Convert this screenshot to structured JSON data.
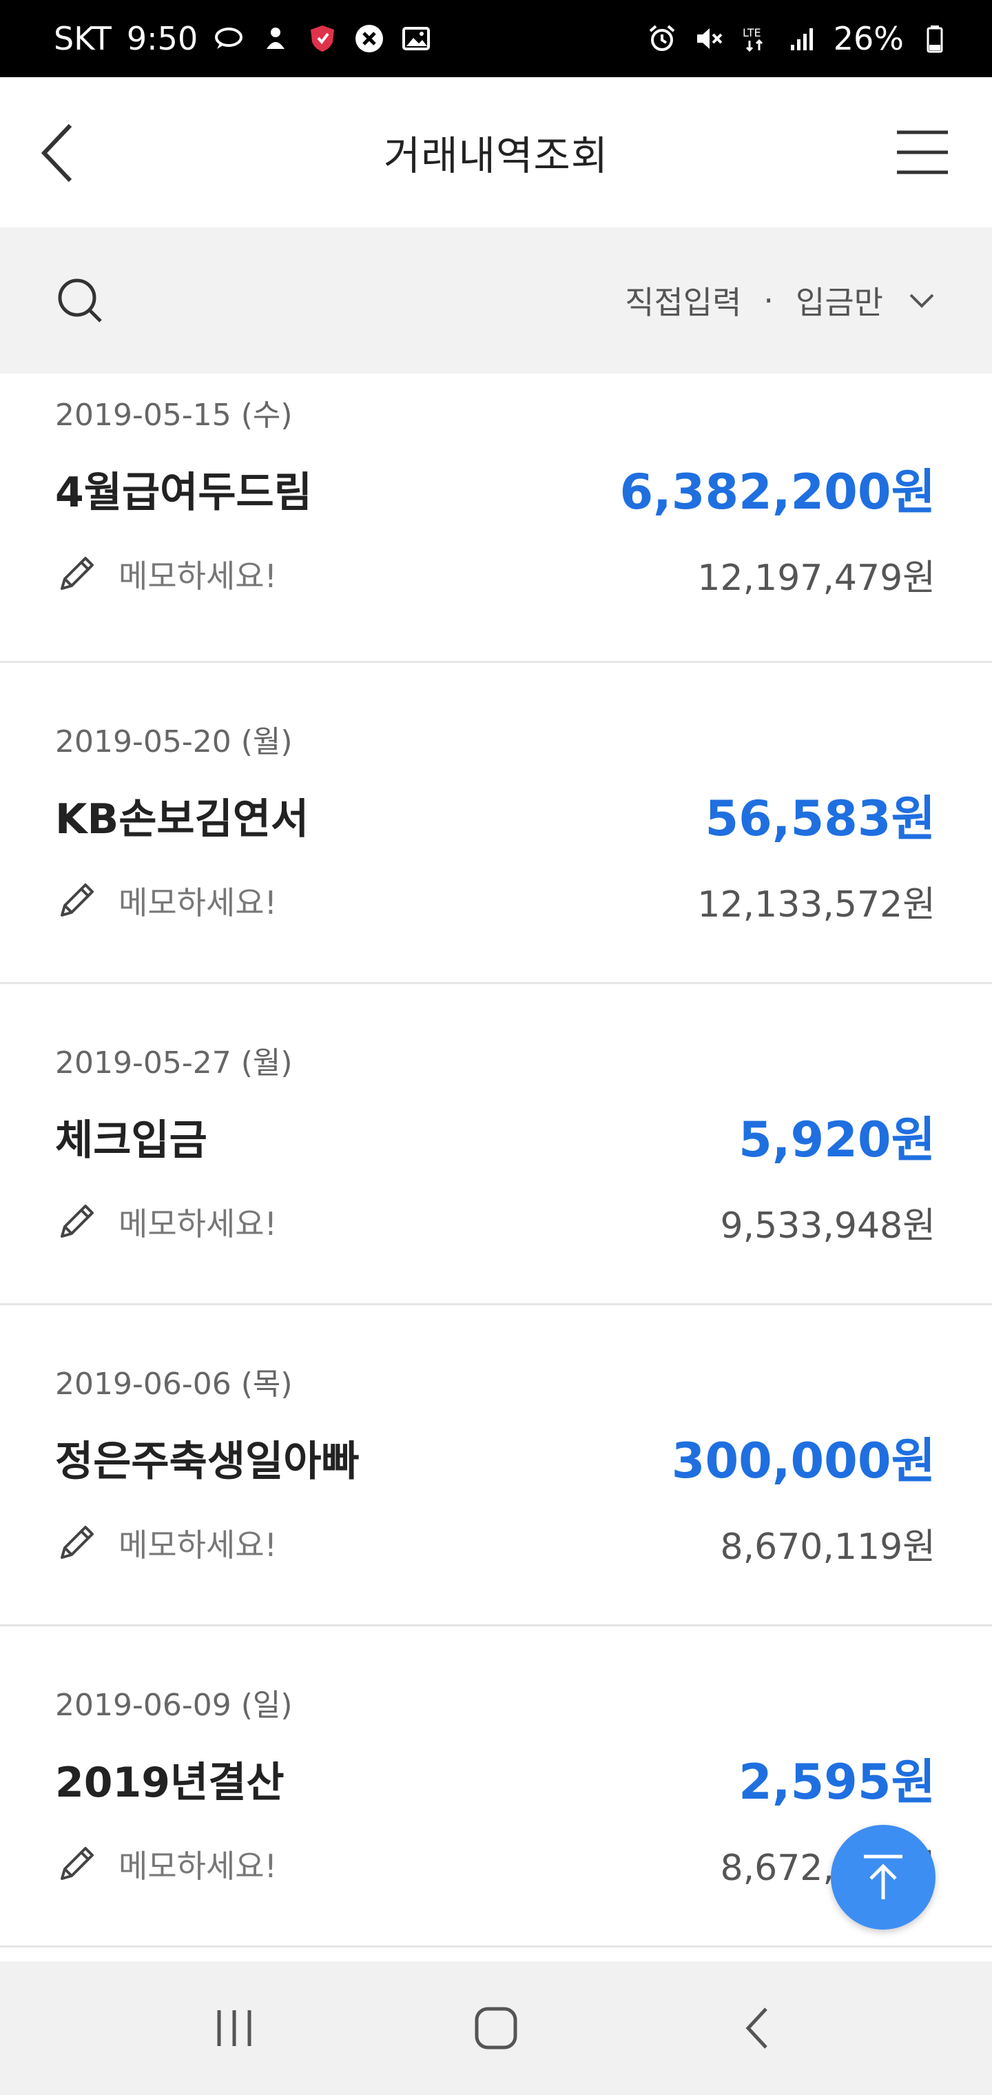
{
  "status_bar": {
    "carrier": "SKT",
    "time": "9:50",
    "battery": "26%",
    "icons_left": [
      "chat-icon",
      "notification-icon",
      "shield-icon",
      "close-circle-icon",
      "image-icon"
    ],
    "icons_right": [
      "alarm-icon",
      "mute-icon",
      "lte-icon",
      "signal-icon",
      "battery-icon"
    ]
  },
  "header": {
    "title": "거래내역조회"
  },
  "filter": {
    "mode": "직접입력",
    "separator": "·",
    "type": "입금만"
  },
  "transactions": [
    {
      "date": "2019-05-15 (수)",
      "name": "4월급여두드림",
      "amount": "6,382,200원",
      "memo_placeholder": "메모하세요!",
      "balance": "12,197,479원"
    },
    {
      "date": "2019-05-20 (월)",
      "name": "KB손보김연서",
      "amount": "56,583원",
      "memo_placeholder": "메모하세요!",
      "balance": "12,133,572원"
    },
    {
      "date": "2019-05-27 (월)",
      "name": "체크입금",
      "amount": "5,920원",
      "memo_placeholder": "메모하세요!",
      "balance": "9,533,948원"
    },
    {
      "date": "2019-06-06 (목)",
      "name": "정은주축생일아빠",
      "amount": "300,000원",
      "memo_placeholder": "메모하세요!",
      "balance": "8,670,119원"
    },
    {
      "date": "2019-06-09 (일)",
      "name": "2019년결산",
      "amount": "2,595원",
      "memo_placeholder": "메모하세요!",
      "balance": "8,672,714원"
    }
  ],
  "colors": {
    "amount": "#1f6fe0",
    "fab": "#3d8ef3",
    "filter_bg": "#f2f2f2"
  }
}
